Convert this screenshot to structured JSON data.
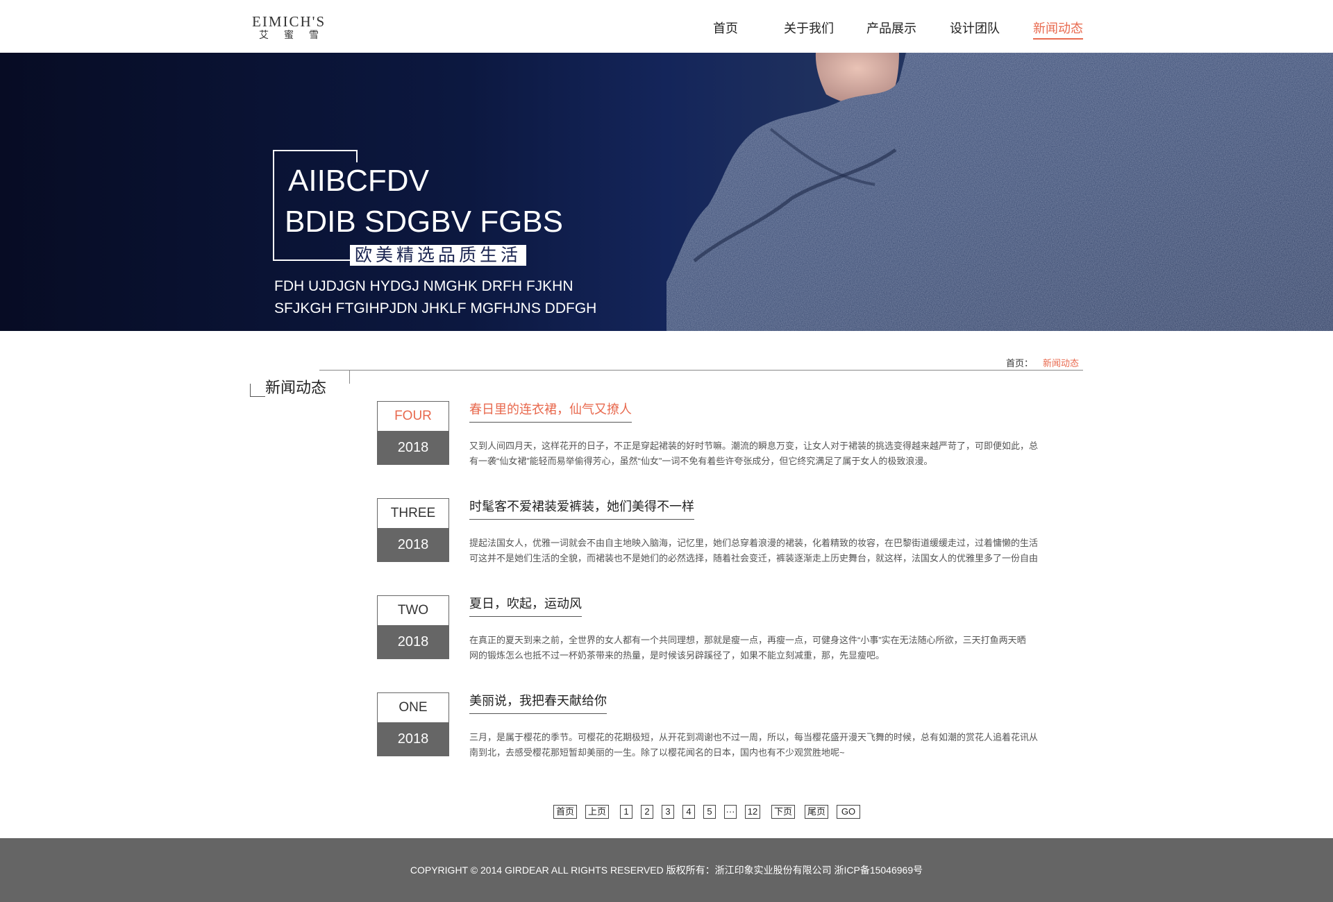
{
  "header": {
    "logo_en": "EIMICH'S",
    "logo_cn": "艾蜜雪",
    "nav": [
      "首页",
      "关于我们",
      "产品展示",
      "设计团队",
      "新闻动态"
    ],
    "active_nav": "新闻动态"
  },
  "banner": {
    "title_line1": "AIIBCFDV",
    "title_line2": "BDIB SDGBV FGBS",
    "tagline": "欧美精选品质生活",
    "sub_line1": "FDH UJDJGN  HYDGJ NMGHK DRFH FJKHN",
    "sub_line2": "SFJKGH FTGIHPJDN JHKLF MGFHJNS  DDFGH"
  },
  "breadcrumb": {
    "home": "首页：",
    "current": "新闻动态"
  },
  "section_title": "新闻动态",
  "news": [
    {
      "word": "FOUR",
      "year": "2018",
      "title": "春日里的连衣裙，仙气又撩人",
      "body_line1": "又到人间四月天，这样花开的日子，不正是穿起裙装的好时节嘛。潮流的瞬息万变，让女人对于裙装的挑选变得越来越严苛了，可即便如此，总",
      "body_line2": "有一袭“仙女裙”能轻而易举偷得芳心，虽然“仙女”一词不免有着些许夸张成分，但它终究满足了属于女人的极致浪漫。"
    },
    {
      "word": "THREE",
      "year": "2018",
      "title": "时髦客不爱裙装爱裤装，她们美得不一样",
      "body_line1": "提起法国女人，优雅一词就会不由自主地映入脑海，记忆里，她们总穿着浪漫的裙装，化着精致的妆容，在巴黎街道缓缓走过，过着慵懒的生活",
      "body_line2": "可这并不是她们生活的全貌，而裙装也不是她们的必然选择，随着社会变迁，裤装逐渐走上历史舞台，就这样，法国女人的优雅里多了一份自由"
    },
    {
      "word": "TWO",
      "year": "2018",
      "title": "夏日，吹起，运动风",
      "body_line1": "在真正的夏天到来之前，全世界的女人都有一个共同理想，那就是瘦一点，再瘦一点，可健身这件“小事”实在无法随心所欲，三天打鱼两天晒",
      "body_line2": "网的锻炼怎么也抵不过一杯奶茶带来的热量，是时候该另辟蹊径了，如果不能立刻减重，那，先显瘦吧。"
    },
    {
      "word": "ONE",
      "year": "2018",
      "title": "美丽说，我把春天献给你",
      "body_line1": "三月，是属于樱花的季节。可樱花的花期极短，从开花到凋谢也不过一周，所以，每当樱花盛开漫天飞舞的时候，总有如潮的赏花人追着花讯从",
      "body_line2": "南到北，去感受樱花那短暂却美丽的一生。除了以樱花闻名的日本，国内也有不少观赏胜地呢~"
    }
  ],
  "pagination": {
    "first": "首页",
    "prev": "上页",
    "pages": [
      "1",
      "2",
      "3",
      "4",
      "5"
    ],
    "ellipsis": "···",
    "last_page": "12",
    "next": "下页",
    "last": "尾页",
    "go": "GO"
  },
  "footer": {
    "copyright": "COPYRIGHT © 2014 GIRDEAR ALL RIGHTS RESERVED 版权所有：浙江印象实业股份有限公司  浙ICP备15046969号"
  },
  "colors": {
    "accent": "#e8694e",
    "date_block": "#666666",
    "footer": "#656565",
    "banner_dark": "#0c1840"
  }
}
